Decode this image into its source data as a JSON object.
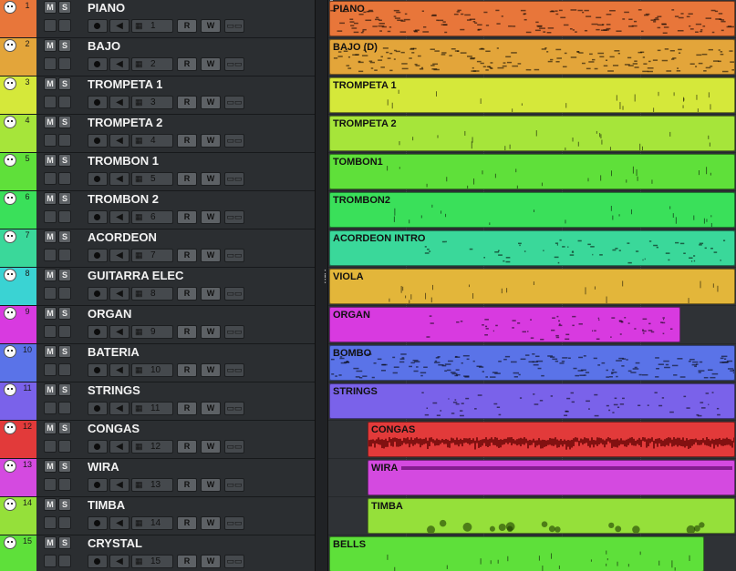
{
  "tracks": [
    {
      "num": "1",
      "name": "PIANO",
      "channel": "1",
      "color": "#e8763a"
    },
    {
      "num": "2",
      "name": "BAJO",
      "channel": "2",
      "color": "#e3a53a"
    },
    {
      "num": "3",
      "name": "TROMPETA 1",
      "channel": "3",
      "color": "#d5e83a"
    },
    {
      "num": "4",
      "name": "TROMPETA 2",
      "channel": "4",
      "color": "#a6e53a"
    },
    {
      "num": "5",
      "name": "TROMBON 1",
      "channel": "5",
      "color": "#5fe03a"
    },
    {
      "num": "6",
      "name": "TROMBON 2",
      "channel": "6",
      "color": "#3ae05a"
    },
    {
      "num": "7",
      "name": "ACORDEON",
      "channel": "7",
      "color": "#3ad89a"
    },
    {
      "num": "8",
      "name": "GUITARRA ELEC",
      "channel": "8",
      "color": "#3ad3d3"
    },
    {
      "num": "9",
      "name": "ORGAN",
      "channel": "9",
      "color": "#d83ae0"
    },
    {
      "num": "10",
      "name": "BATERIA",
      "channel": "10",
      "color": "#5a73e8"
    },
    {
      "num": "11",
      "name": "STRINGS",
      "channel": "11",
      "color": "#7a62ea"
    },
    {
      "num": "12",
      "name": "CONGAS",
      "channel": "12",
      "color": "#e23a3a"
    },
    {
      "num": "13",
      "name": "WIRA",
      "channel": "13",
      "color": "#d44ae0"
    },
    {
      "num": "14",
      "name": "TIMBA",
      "channel": "14",
      "color": "#95e03a"
    },
    {
      "num": "15",
      "name": "CRYSTAL",
      "channel": "15",
      "color": "#5ee03a"
    }
  ],
  "buttons": {
    "mute": "M",
    "solo": "S",
    "read": "R",
    "write": "W"
  },
  "icons": {
    "track": "midi-port-icon",
    "record": "record-icon",
    "monitor": "speaker-icon",
    "channel": "grid-icon",
    "edit": "editor-icon"
  },
  "parts": [
    {
      "track": 1,
      "label": "PIANO",
      "color": "#e8763a",
      "start": 0.0,
      "end": 1.0,
      "notes": "dense"
    },
    {
      "track": 2,
      "label": "BAJO (D)",
      "color": "#e3a53a",
      "start": 0.0,
      "end": 1.0,
      "notes": "dense"
    },
    {
      "track": 3,
      "label": "TROMPETA 1",
      "color": "#d5e83a",
      "start": 0.0,
      "end": 1.0,
      "notes": "sparse"
    },
    {
      "track": 4,
      "label": "TROMPETA 2",
      "color": "#a6e53a",
      "start": 0.0,
      "end": 1.0,
      "notes": "sparse"
    },
    {
      "track": 5,
      "label": "TOMBON1",
      "color": "#5fe03a",
      "start": 0.0,
      "end": 1.0,
      "notes": "sparse"
    },
    {
      "track": 6,
      "label": "TROMBON2",
      "color": "#3ae05a",
      "start": 0.0,
      "end": 1.0,
      "notes": "sparse"
    },
    {
      "track": 7,
      "label": "ACORDEON INTRO",
      "color": "#3ad89a",
      "start": 0.0,
      "end": 1.0,
      "notes": "medium"
    },
    {
      "track": 8,
      "label": "VIOLA",
      "color": "#e3b63a",
      "start": 0.0,
      "end": 1.0,
      "notes": "sparse"
    },
    {
      "track": 9,
      "label": "ORGAN",
      "color": "#d83ae0",
      "start": 0.0,
      "end": 0.865,
      "notes": "medium"
    },
    {
      "track": 10,
      "label": "BOMBO",
      "color": "#5a73e8",
      "start": 0.0,
      "end": 1.0,
      "notes": "dense"
    },
    {
      "track": 11,
      "label": "STRINGS",
      "color": "#7a62ea",
      "start": 0.0,
      "end": 1.0,
      "notes": "medium"
    },
    {
      "track": 12,
      "label": "CONGAS",
      "color": "#e23a3a",
      "start": 0.095,
      "end": 1.0,
      "notes": "wave"
    },
    {
      "track": 13,
      "label": "WIRA",
      "color": "#d44ae0",
      "start": 0.095,
      "end": 1.0,
      "notes": "bar"
    },
    {
      "track": 14,
      "label": "TIMBA",
      "color": "#95e03a",
      "start": 0.095,
      "end": 1.0,
      "notes": "blobs"
    },
    {
      "track": 15,
      "label": "BELLS",
      "color": "#5ee03a",
      "start": 0.0,
      "end": 0.925,
      "notes": "sparse"
    }
  ]
}
